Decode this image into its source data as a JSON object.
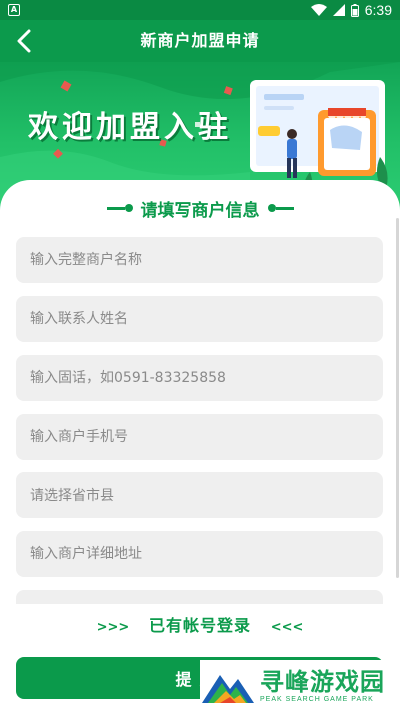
{
  "status_bar": {
    "time": "6:39"
  },
  "header": {
    "title": "新商户加盟申请"
  },
  "banner": {
    "headline": "欢迎加盟入驻"
  },
  "form": {
    "section_title": "请填写商户信息",
    "fields": [
      {
        "placeholder": "输入完整商户名称"
      },
      {
        "placeholder": "输入联系人姓名"
      },
      {
        "placeholder": "输入固话，如0591-83325858"
      },
      {
        "placeholder": "输入商户手机号"
      },
      {
        "placeholder": "请选择省市县"
      },
      {
        "placeholder": "输入商户详细地址"
      }
    ]
  },
  "login_link": {
    "left_arrows": ">>>",
    "label": "已有帐号登录",
    "right_arrows": "<<<"
  },
  "submit": {
    "label": "提交"
  },
  "watermark": {
    "name": "寻峰游戏园",
    "sub": "PEAK SEARCH GAME PARK"
  },
  "colors": {
    "primary": "#0c9a4c",
    "status_bar": "#0a8a43",
    "field_bg": "#efefef"
  }
}
